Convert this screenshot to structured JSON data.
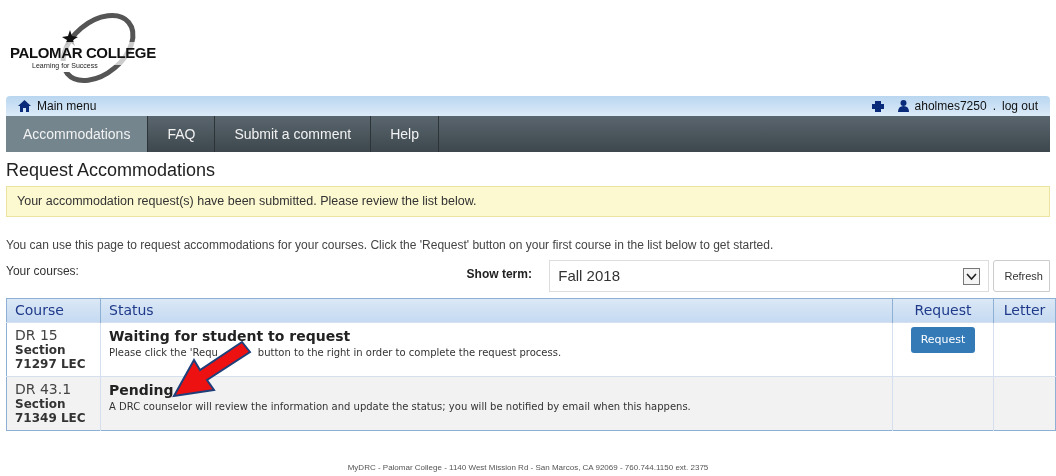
{
  "logo": {
    "name": "PALOMAR COLLEGE",
    "tagline": "Learning for Success"
  },
  "top_bar": {
    "main_menu": "Main menu",
    "user": "aholmes7250",
    "separator": ".",
    "logout": "log out"
  },
  "nav": [
    {
      "label": "Accommodations",
      "selected": true
    },
    {
      "label": "FAQ",
      "selected": false
    },
    {
      "label": "Submit a comment",
      "selected": false
    },
    {
      "label": "Help",
      "selected": false
    }
  ],
  "title": "Request Accommodations",
  "alert": "Your accommodation request(s) have been submitted. Please review the list below.",
  "intro": "You can use this page to request accommodations for your courses. Click the 'Request' button on your first course in the list below to get started.",
  "courses_label": "Your courses:",
  "term": {
    "label": "Show term:",
    "value": "Fall 2018",
    "refresh": "Refresh"
  },
  "table": {
    "columns": [
      "Course",
      "Status",
      "Request",
      "Letter"
    ],
    "rows": [
      {
        "course": "DR 15",
        "section_label": "Section",
        "section": "71297 LEC",
        "status": "Waiting for student to request",
        "desc_before": "Please click the 'Requ",
        "desc_after": "button to the right in order to complete the request process.",
        "request_button": "Request"
      },
      {
        "course": "DR 43.1",
        "section_label": "Section",
        "section": "71349 LEC",
        "status": "Pending",
        "desc": "A DRC counselor will review the information and update the status; you will be notified by email when this happens."
      }
    ]
  },
  "footer": "MyDRC - Palomar College - 1140 West Mission Rd - San Marcos, CA 92069 - 760.744.1150 ext. 2375"
}
